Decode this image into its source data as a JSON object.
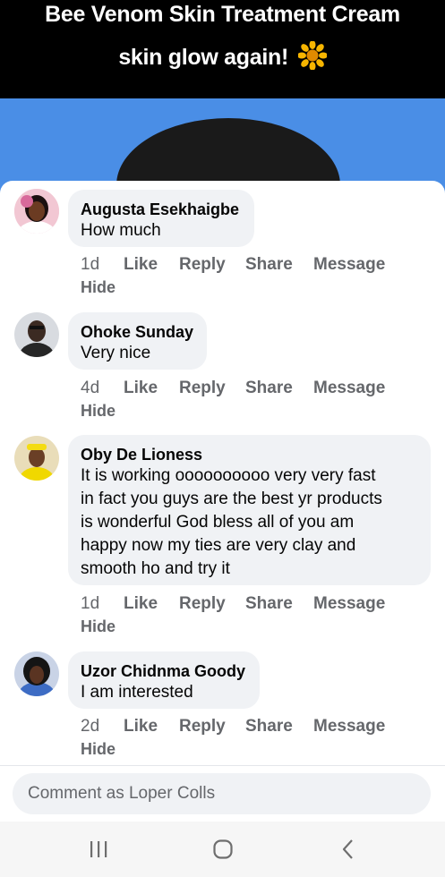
{
  "header": {
    "line1": "Bee Venom Skin Treatment Cream",
    "line2": "skin glow again!",
    "emoji": "sunflower-icon"
  },
  "comments": [
    {
      "author": "Augusta Esekhaigbe",
      "text": "How much",
      "time": "1d",
      "like": "Like",
      "reply": "Reply",
      "share": "Share",
      "message": "Message",
      "hide": "Hide"
    },
    {
      "author": "Ohoke Sunday",
      "text": "Very nice",
      "time": "4d",
      "like": "Like",
      "reply": "Reply",
      "share": "Share",
      "message": "Message",
      "hide": "Hide"
    },
    {
      "author": "Oby De Lioness",
      "text_lines": [
        "It is working oooooooooo very very fast",
        "in fact you guys are the best yr products",
        "is wonderful God bless all of you  am",
        "happy now my ties are very clay and",
        "smooth ho and try it"
      ],
      "time": "1d",
      "like": "Like",
      "reply": "Reply",
      "share": "Share",
      "message": "Message",
      "hide": "Hide"
    },
    {
      "author": "Uzor Chidnma Goody",
      "text": "I am interested",
      "time": "2d",
      "like": "Like",
      "reply": "Reply",
      "share": "Share",
      "message": "Message",
      "hide": "Hide"
    }
  ],
  "composer": {
    "placeholder": "Comment as Loper Colls"
  },
  "navbar": {
    "recents": "recents-icon",
    "home": "home-icon",
    "back": "back-icon"
  }
}
